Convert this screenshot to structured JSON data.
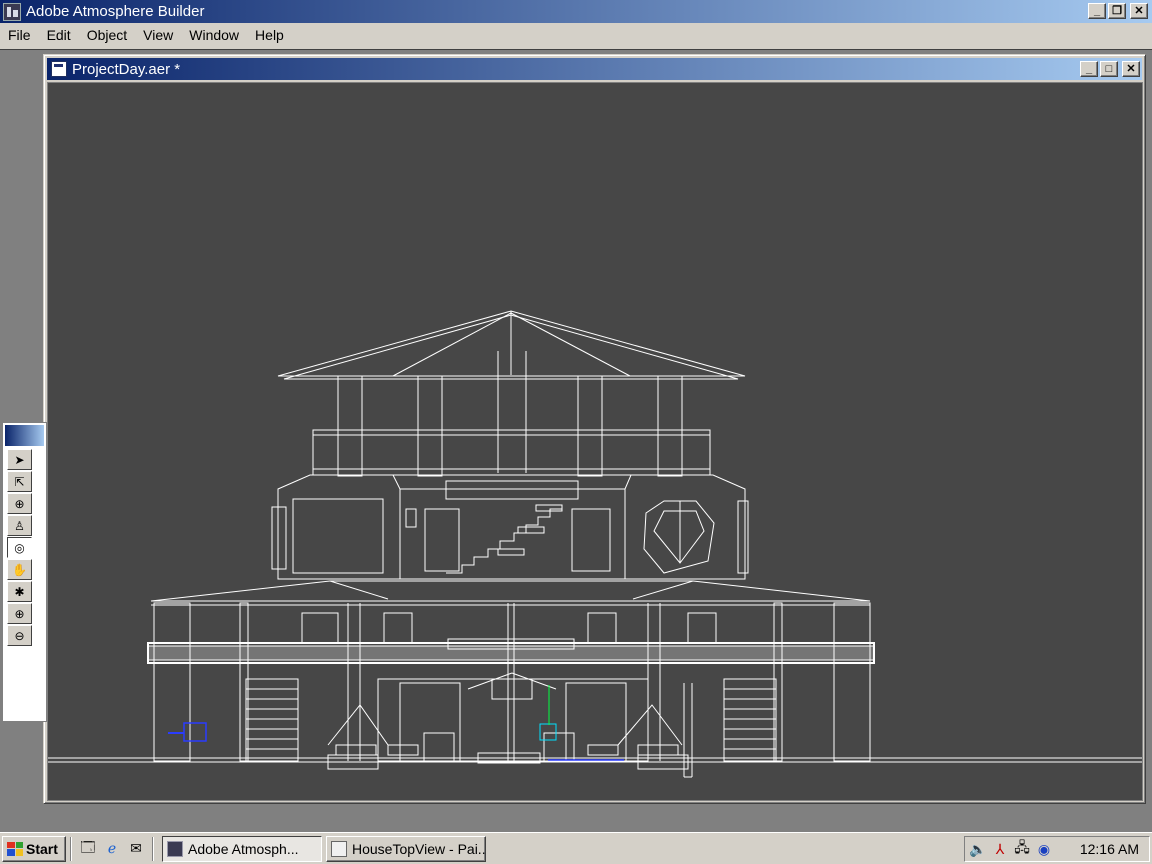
{
  "app": {
    "title": "Adobe Atmosphere Builder"
  },
  "menu": [
    "File",
    "Edit",
    "Object",
    "View",
    "Window",
    "Help"
  ],
  "document": {
    "title": "ProjectDay.aer *"
  },
  "toolbox": {
    "tools": [
      {
        "name": "select-arrow-icon",
        "glyph": "➤"
      },
      {
        "name": "direct-select-icon",
        "glyph": "⇱"
      },
      {
        "name": "orbit-object-icon",
        "glyph": "⊕"
      },
      {
        "name": "walk-icon",
        "glyph": "♙"
      },
      {
        "name": "orbit-camera-icon",
        "glyph": "◎"
      },
      {
        "name": "hand-pan-icon",
        "glyph": "✋"
      },
      {
        "name": "crosshair-tool-icon",
        "glyph": "✱"
      },
      {
        "name": "zoom-in-icon",
        "glyph": "⊕"
      },
      {
        "name": "zoom-out-icon",
        "glyph": "⊖"
      }
    ],
    "active_index": 4
  },
  "taskbar": {
    "start_label": "Start",
    "tasks": [
      "Adobe Atmosph...",
      "HouseTopView - Pai..."
    ],
    "active_task": 0,
    "clock": "12:16 AM"
  },
  "colors": {
    "titlebar_start": "#0a246a",
    "titlebar_end": "#a6caf0",
    "viewport_bg": "#474747",
    "wire": "#ffffff"
  }
}
